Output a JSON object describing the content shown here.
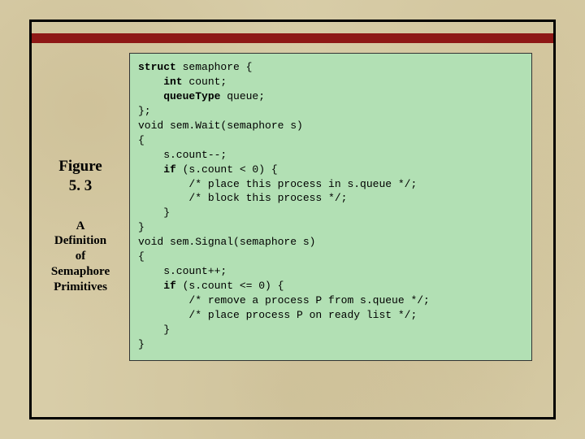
{
  "figure": {
    "label_line1": "Figure",
    "label_line2": "5. 3",
    "caption_line1": "A",
    "caption_line2": "Definition",
    "caption_line3": "of",
    "caption_line4": "Semaphore",
    "caption_line5": "Primitives"
  },
  "code": {
    "l01a": "struct",
    "l01b": " semaphore {",
    "l02a": "    int",
    "l02b": " count;",
    "l03a": "    queueType",
    "l03b": " queue;",
    "l04": "};",
    "l05": "void sem.Wait(semaphore s)",
    "l06": "{",
    "l07": "    s.count--;",
    "l08a": "    if",
    "l08b": " (s.count < 0) {",
    "l09": "        /* place this process in s.queue */;",
    "l10": "        /* block this process */;",
    "l11": "    }",
    "l12": "}",
    "l13": "void sem.Signal(semaphore s)",
    "l14": "{",
    "l15": "    s.count++;",
    "l16a": "    if",
    "l16b": " (s.count <= 0) {",
    "l17": "        /* remove a process P from s.queue */;",
    "l18": "        /* place process P on ready list */;",
    "l19": "    }",
    "l20": "}"
  }
}
